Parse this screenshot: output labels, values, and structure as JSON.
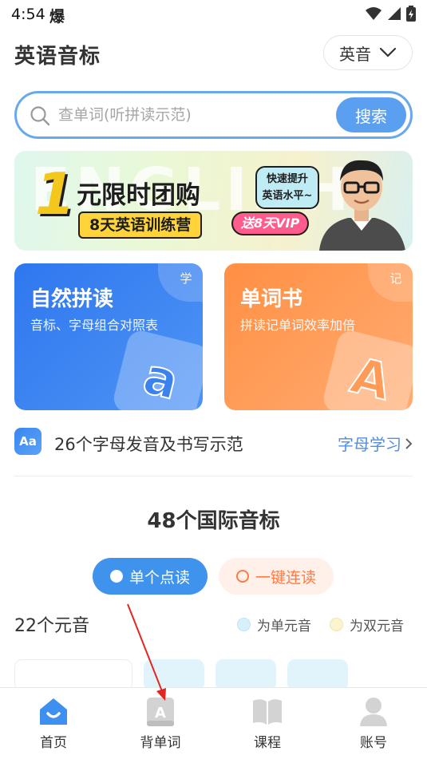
{
  "status_bar": {
    "time": "4:54",
    "notification_glyph": "爆"
  },
  "header": {
    "title": "英语音标",
    "accent_selector": {
      "value": "英音"
    }
  },
  "search": {
    "placeholder": "查单词(听拼读示范)",
    "button_label": "搜索"
  },
  "banner": {
    "bg_text": "ENGLISH",
    "number": "1",
    "title": "元限时团购",
    "tag": "8天英语训练营",
    "bubble_line1": "快速提升",
    "bubble_line2": "英语水平~",
    "vip": "送8天VIP"
  },
  "cards": [
    {
      "title": "自然拼读",
      "desc": "音标、字母组合对照表",
      "corner": "学",
      "tile_letter": "a",
      "colors": {
        "accent": "#2f77ef"
      }
    },
    {
      "title": "单词书",
      "desc": "拼读记单词效率加倍",
      "corner": "记",
      "tile_letter": "A",
      "colors": {
        "accent": "#ff8f43"
      }
    }
  ],
  "letters_row": {
    "icon_text": "Aa",
    "text": "26个字母发音及书写示范",
    "link": "字母学习"
  },
  "phonetics": {
    "section_title": "48个国际音标",
    "modes": {
      "single": "单个点读",
      "continuous": "一键连读"
    },
    "vowel_title": "22个元音",
    "legend": [
      {
        "label": "为单元音",
        "color": "#d8f0fb"
      },
      {
        "label": "为双元音",
        "color": "#fbf4cf"
      }
    ]
  },
  "tabs": [
    {
      "label": "首页",
      "icon": "home-icon",
      "active": true
    },
    {
      "label": "背单词",
      "icon": "word-book-icon",
      "active": false
    },
    {
      "label": "课程",
      "icon": "course-book-icon",
      "active": false
    },
    {
      "label": "账号",
      "icon": "account-icon",
      "active": false
    }
  ],
  "colors": {
    "primary": "#3f93ed",
    "orange": "#ff7a45",
    "annotation": "#e3261f"
  }
}
